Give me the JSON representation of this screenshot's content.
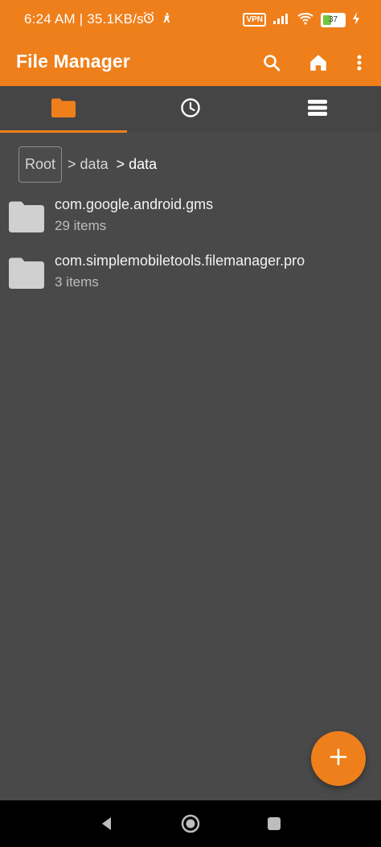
{
  "status_bar": {
    "time_speed": "6:24 AM | 35.1KB/s",
    "vpn_label": "VPN",
    "battery_level": "37",
    "battery_percent": 37,
    "icons": [
      "alarm-icon",
      "person-icon",
      "signal-icon",
      "wifi-icon",
      "battery-icon",
      "charging-icon"
    ]
  },
  "toolbar": {
    "title": "File Manager",
    "actions": [
      "search-icon",
      "home-icon",
      "more-vert-icon"
    ]
  },
  "tabs": [
    {
      "name": "files",
      "icon": "folder-icon",
      "active": true
    },
    {
      "name": "recents",
      "icon": "clock-icon",
      "active": false
    },
    {
      "name": "storage",
      "icon": "storage-icon",
      "active": false
    }
  ],
  "breadcrumb": {
    "root": "Root",
    "items": [
      "> data",
      "> data"
    ]
  },
  "files": [
    {
      "name": "com.google.android.gms",
      "count": "29 items"
    },
    {
      "name": "com.simplemobiletools.filemanager.pro",
      "count": "3 items"
    }
  ],
  "fab": {
    "icon": "plus-icon"
  },
  "colors": {
    "accent": "#ef7f1a",
    "background": "#494949",
    "tab_background": "#454545",
    "nav_background": "#000000"
  }
}
